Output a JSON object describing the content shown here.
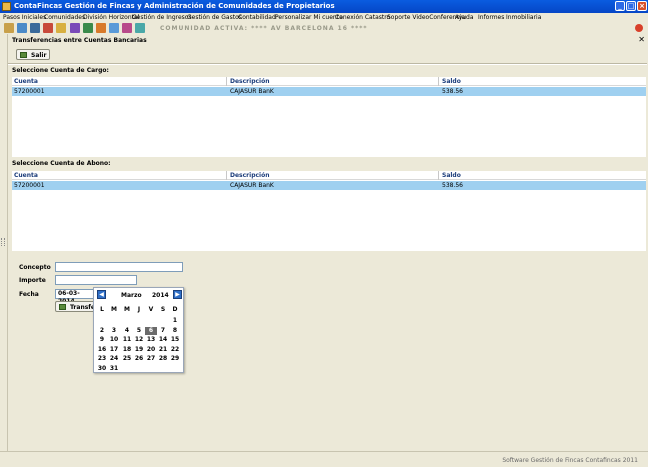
{
  "window": {
    "title": "ContaFincas Gestión de Fincas y Administración de Comunidades de Propietarios"
  },
  "menu": [
    "Pasos Iniciales",
    "Comunidades",
    "División Horizontal",
    "Gestión de Ingresos",
    "Gestión de Gastos",
    "Contabilidad",
    "Personalizar Mi cuenta",
    "Conexión Catastro",
    "Soporte VideoConferencia",
    "Ayuda",
    "Informes",
    "Inmobiliaria"
  ],
  "toolbar": {
    "community_label": "COMUNIDAD ACTIVA: **** AV BARCELONA 16 ****"
  },
  "panel": {
    "title": "Transferencias entre Cuentas Bancarias",
    "close": "✕",
    "exit_button": "Salir"
  },
  "cargo": {
    "section_label": "Seleccione Cuenta de Cargo:",
    "columns": [
      "Cuenta",
      "Descripción",
      "Saldo"
    ],
    "rows": [
      {
        "cuenta": "57200001",
        "descripcion": "CAJASUR  BanK",
        "saldo": "538.56"
      }
    ]
  },
  "abono": {
    "section_label": "Seleccione Cuenta de Abono:",
    "columns": [
      "Cuenta",
      "Descripción",
      "Saldo"
    ],
    "rows": [
      {
        "cuenta": "57200001",
        "descripcion": "CAJASUR  BanK",
        "saldo": "538.56"
      }
    ]
  },
  "form": {
    "concepto_label": "Concepto",
    "concepto_value": "",
    "importe_label": "Importe",
    "importe_value": "",
    "fecha_label": "Fecha",
    "fecha_value": "06-03-2014",
    "transfer_button": "Transfer"
  },
  "calendar": {
    "month": "Marzo",
    "year": "2014",
    "prev": "◀",
    "next": "▶",
    "weekdays": [
      "L",
      "M",
      "M",
      "J",
      "V",
      "S",
      "D"
    ],
    "selected_day": "6",
    "weeks": [
      [
        "",
        "",
        "",
        "",
        "",
        "",
        "1"
      ],
      [
        "2",
        "3",
        "4",
        "5",
        "6",
        "7",
        "8"
      ],
      [
        "9",
        "10",
        "11",
        "12",
        "13",
        "14",
        "15"
      ],
      [
        "16",
        "17",
        "18",
        "19",
        "20",
        "21",
        "22"
      ],
      [
        "23",
        "24",
        "25",
        "26",
        "27",
        "28",
        "29"
      ],
      [
        "30",
        "31",
        "",
        "",
        "",
        "",
        ""
      ]
    ]
  },
  "status": {
    "text": "Software Gestión de Fincas Contafincas 2011"
  },
  "colors": {
    "titlebar": "#0a5ce0",
    "selected_row": "#9fd0f0",
    "background": "#ece9d8"
  }
}
